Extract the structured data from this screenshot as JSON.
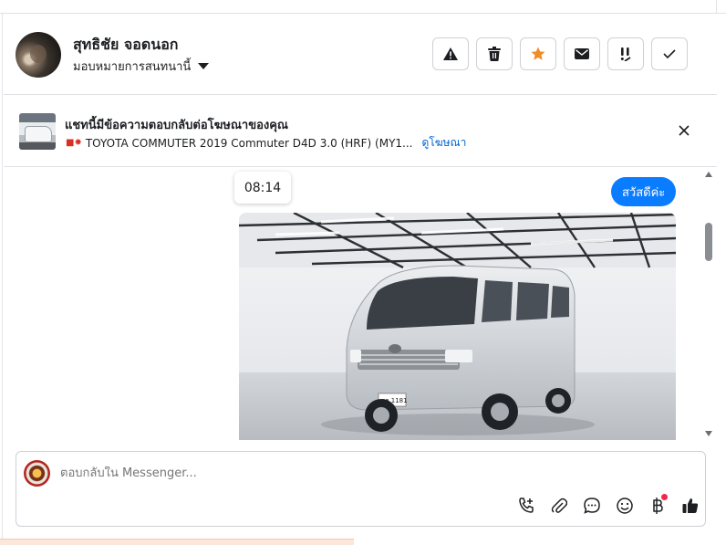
{
  "header": {
    "contact_name": "สุทธิชัย จอดนอก",
    "assign_label": "มอบหมายการสนทนานี้",
    "actions": [
      {
        "name": "report-button",
        "icon": "warning-icon"
      },
      {
        "name": "delete-button",
        "icon": "trash-icon"
      },
      {
        "name": "star-button",
        "icon": "star-icon"
      },
      {
        "name": "mark-unread-button",
        "icon": "envelope-icon"
      },
      {
        "name": "follow-up-button",
        "icon": "double-exclamation-icon"
      },
      {
        "name": "mark-done-button",
        "icon": "check-icon"
      }
    ],
    "star_color": "#f28c28"
  },
  "ad_banner": {
    "title": "แชทนี้มีข้อความตอบกลับต่อโฆษณาของคุณ",
    "subtitle": "TOYOTA COMMUTER 2019 Commuter D4D 3.0 (HRF) (MY1...",
    "link_label": "ดูโฆษณา"
  },
  "thread": {
    "timestamp": "08:14",
    "message": "สวัสดีค่ะ",
    "bubble_color": "#0a7cff",
    "photo_plate": "ฮฮ 1181"
  },
  "composer": {
    "placeholder": "ตอบกลับใน Messenger...",
    "tools": [
      "add-call-icon",
      "paperclip-icon",
      "speech-bubble-icon",
      "smiley-icon",
      "baht-icon",
      "thumbs-up-icon"
    ]
  }
}
